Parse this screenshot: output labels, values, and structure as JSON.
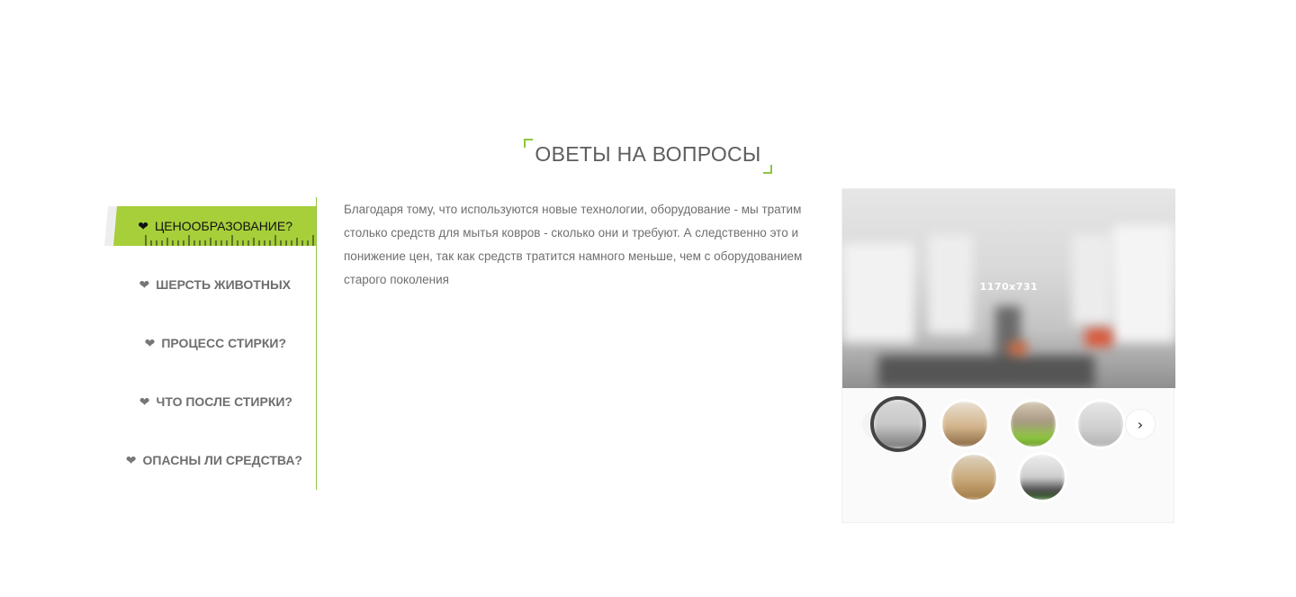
{
  "section": {
    "title": "ОВЕТЫ НА ВОПРОСЫ"
  },
  "tabs": [
    {
      "label": "ЦЕНООБРАЗОВАНИЕ?",
      "icon": "heart-icon",
      "active": true
    },
    {
      "label": "ШЕРСТЬ ЖИВОТНЫХ",
      "icon": "heart-icon",
      "active": false
    },
    {
      "label": "ПРОЦЕСС СТИРКИ?",
      "icon": "heart-icon",
      "active": false
    },
    {
      "label": "ЧТО ПОСЛЕ СТИРКИ?",
      "icon": "heart-icon",
      "active": false
    },
    {
      "label": "ОПАСНЫ ЛИ СРЕДСТВА?",
      "icon": "heart-icon",
      "active": false
    }
  ],
  "answer": {
    "text": "Благодаря тому, что используются новые технологии, оборудование - мы тратим столько средств для мытья ковров - сколько они и требуют. А следственно это и понижение цен, так как средств тратится намного меньше, чем с оборудованием старого поколения"
  },
  "gallery": {
    "main_label": "1170x731",
    "next_icon": "chevron-right-icon",
    "thumbnails": 6
  },
  "colors": {
    "accent": "#8dc63f",
    "text": "#6f6f6f"
  }
}
